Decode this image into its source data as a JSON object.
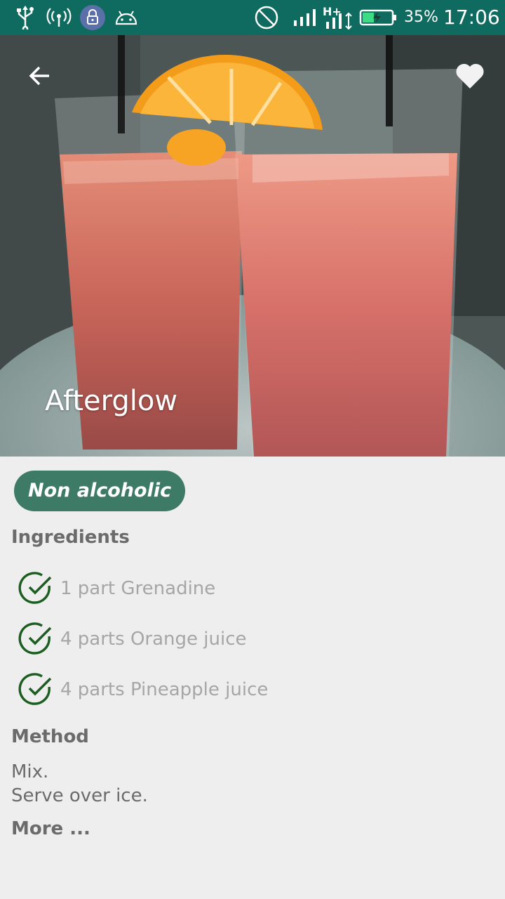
{
  "status_bar": {
    "battery_percent": "35%",
    "time": "17:06",
    "network_type": "H+",
    "icons": [
      "usb-icon",
      "hotspot-icon",
      "vpn-lock-icon",
      "android-debug-icon",
      "do-not-disturb-icon",
      "signal-icon",
      "data-signal-icon",
      "battery-charging-icon"
    ],
    "colors": {
      "background": "#0f6b5f",
      "battery_fill": "#3ddc84"
    }
  },
  "hero": {
    "title": "Afterglow",
    "back_icon": "arrow-back-icon",
    "favorite_icon": "heart-icon"
  },
  "detail": {
    "category_chip": "Non alcoholic",
    "ingredients_title": "Ingredients",
    "ingredients": [
      {
        "label": "1 part Grenadine",
        "icon": "check-circle-icon"
      },
      {
        "label": "4 parts Orange juice",
        "icon": "check-circle-icon"
      },
      {
        "label": "4 parts Pineapple juice",
        "icon": "check-circle-icon"
      }
    ],
    "method_title": "Method",
    "method_lines": [
      "Mix.",
      "Serve over ice."
    ],
    "more_link": "More ..."
  },
  "colors": {
    "chip": "#3e7b66",
    "check": "#1b5e20",
    "heading_text": "#6b6b6b",
    "ingredient_text": "#a6a6a6",
    "background": "#eeeeee"
  }
}
